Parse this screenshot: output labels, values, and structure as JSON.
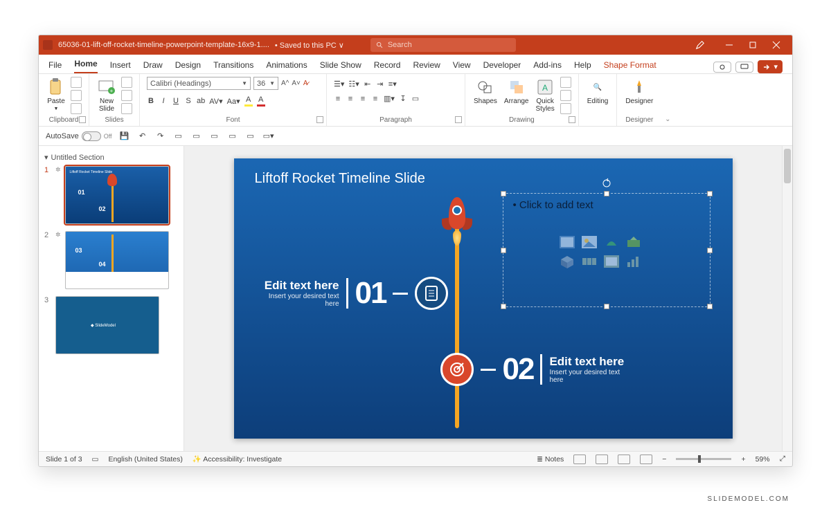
{
  "titlebar": {
    "filename": "65036-01-lift-off-rocket-timeline-powerpoint-template-16x9-1....",
    "saved_status": "• Saved to this PC ∨",
    "search_placeholder": "Search"
  },
  "tabs": [
    "File",
    "Home",
    "Insert",
    "Draw",
    "Design",
    "Transitions",
    "Animations",
    "Slide Show",
    "Record",
    "Review",
    "View",
    "Developer",
    "Add-ins",
    "Help",
    "Shape Format"
  ],
  "active_tab": "Home",
  "context_tab": "Shape Format",
  "ribbon": {
    "clipboard": {
      "label": "Clipboard",
      "paste": "Paste"
    },
    "slides": {
      "label": "Slides",
      "new_slide": "New\nSlide"
    },
    "font": {
      "label": "Font",
      "family": "Calibri (Headings)",
      "size": "36"
    },
    "paragraph": {
      "label": "Paragraph"
    },
    "drawing": {
      "label": "Drawing",
      "shapes": "Shapes",
      "arrange": "Arrange",
      "quick_styles": "Quick\nStyles"
    },
    "editing": {
      "label": "Editing",
      "btn": "Editing"
    },
    "designer": {
      "label": "Designer",
      "btn": "Designer"
    }
  },
  "qat": {
    "autosave_label": "AutoSave",
    "autosave_state": "Off"
  },
  "section_name": "Untitled Section",
  "thumbs": [
    {
      "num": "1",
      "selected": true
    },
    {
      "num": "2",
      "selected": false
    },
    {
      "num": "3",
      "selected": false
    }
  ],
  "slide": {
    "title": "Liftoff Rocket Timeline Slide",
    "m1": {
      "num": "01",
      "heading": "Edit text here",
      "sub": "Insert your desired text here"
    },
    "m2": {
      "num": "02",
      "heading": "Edit text here",
      "sub": "Insert your desired text here"
    },
    "placeholder_prompt": "Click to add text"
  },
  "status": {
    "slide_of": "Slide 1 of 3",
    "lang": "English (United States)",
    "a11y": "Accessibility: Investigate",
    "notes": "Notes",
    "zoom": "59%"
  },
  "watermark": "SLIDEMODEL.COM"
}
